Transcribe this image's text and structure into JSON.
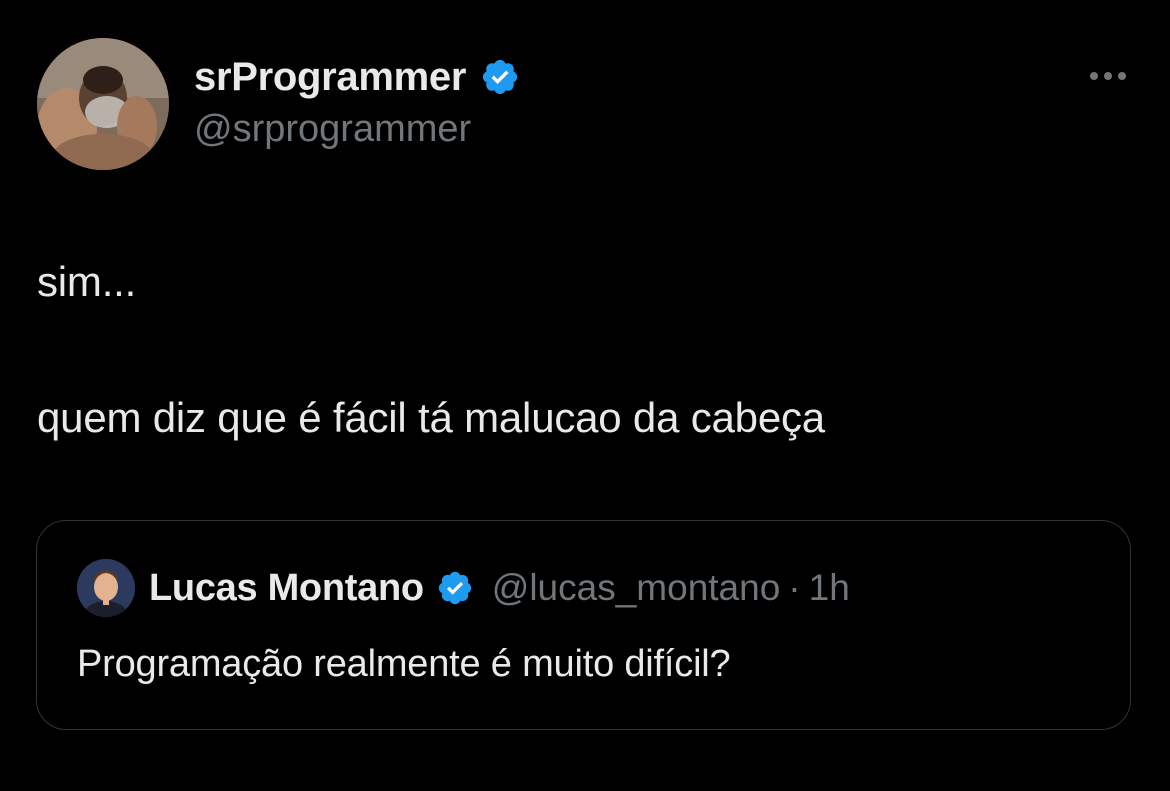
{
  "tweet": {
    "author": {
      "name": "srProgrammer",
      "handle": "@srprogrammer",
      "avatar_icon": "user-avatar-photo",
      "verified_icon": "verified-badge-icon"
    },
    "more_icon": "more-options-icon",
    "text_lines": [
      "sim...",
      "quem diz que é fácil tá malucao da cabeça"
    ]
  },
  "quote": {
    "author": {
      "name": "Lucas Montano",
      "handle": "@lucas_montano",
      "avatar_icon": "user-avatar-photo",
      "verified_icon": "verified-badge-icon"
    },
    "separator": "·",
    "time": "1h",
    "text": "Programação realmente é muito difícil?"
  },
  "colors": {
    "background": "#000000",
    "primary_text": "#e7e9ea",
    "secondary_text": "#71767b",
    "verified_blue": "#1d9bf0",
    "border": "#2f3336"
  }
}
